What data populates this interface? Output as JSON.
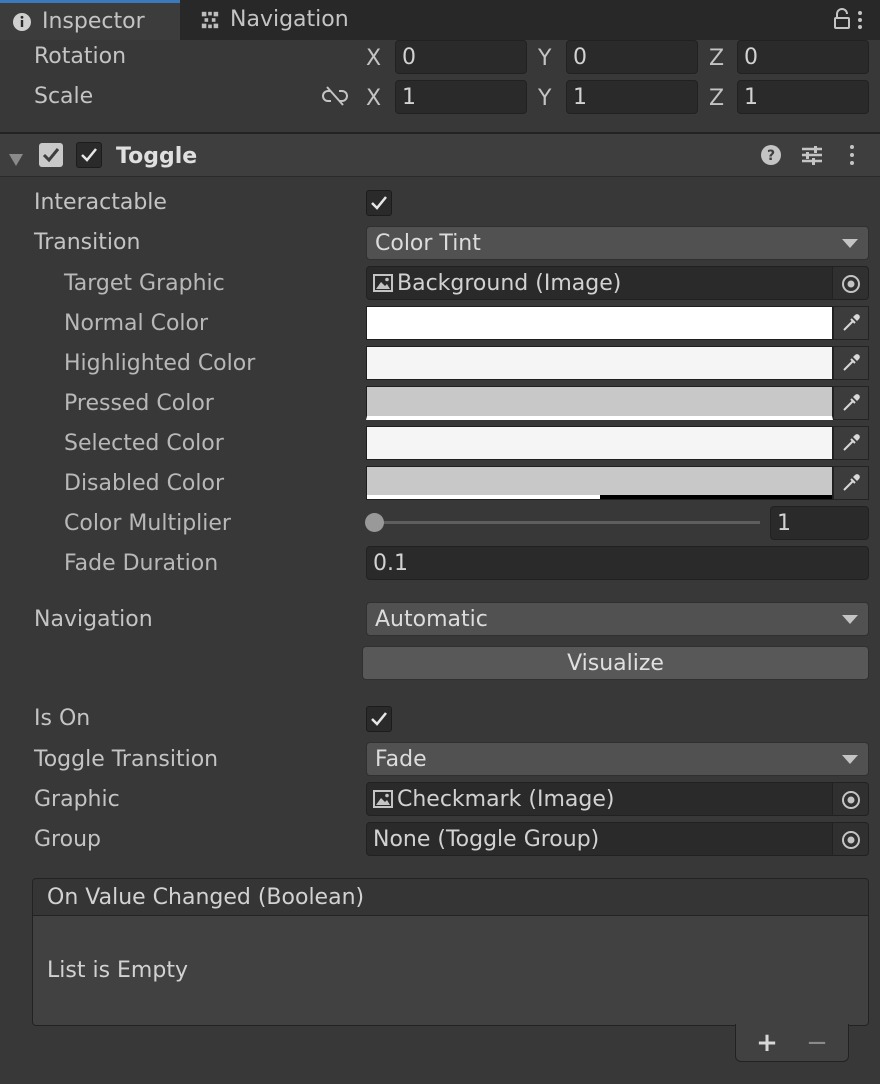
{
  "tabs": {
    "inspector": "Inspector",
    "navigation": "Navigation"
  },
  "transform": {
    "rotation": {
      "label": "Rotation",
      "x": "0",
      "y": "0",
      "z": "0"
    },
    "scale": {
      "label": "Scale",
      "x": "1",
      "y": "1",
      "z": "1"
    },
    "axis_x": "X",
    "axis_y": "Y",
    "axis_z": "Z"
  },
  "component": {
    "title": "Toggle",
    "enabled": true
  },
  "fields": {
    "interactable": {
      "label": "Interactable",
      "checked": true
    },
    "transition": {
      "label": "Transition",
      "value": "Color Tint"
    },
    "target_graphic": {
      "label": "Target Graphic",
      "value": "Background (Image)"
    },
    "normal_color": {
      "label": "Normal Color",
      "color": "#FFFFFF"
    },
    "highlighted_color": {
      "label": "Highlighted Color",
      "color": "#F5F5F5"
    },
    "pressed_color": {
      "label": "Pressed Color",
      "color": "#C8C8C8"
    },
    "selected_color": {
      "label": "Selected Color",
      "color": "#F5F5F5"
    },
    "disabled_color": {
      "label": "Disabled Color",
      "color": "#C8C8C8"
    },
    "color_multiplier": {
      "label": "Color Multiplier",
      "value": "1",
      "slider_fraction": 0
    },
    "fade_duration": {
      "label": "Fade Duration",
      "value": "0.1"
    },
    "navigation": {
      "label": "Navigation",
      "value": "Automatic"
    },
    "visualize_button": "Visualize",
    "is_on": {
      "label": "Is On",
      "checked": true
    },
    "toggle_transition": {
      "label": "Toggle Transition",
      "value": "Fade"
    },
    "graphic": {
      "label": "Graphic",
      "value": "Checkmark (Image)"
    },
    "group": {
      "label": "Group",
      "value": "None (Toggle Group)"
    }
  },
  "event": {
    "header": "On Value Changed (Boolean)",
    "empty_text": "List is Empty",
    "add": "+",
    "remove": "−"
  },
  "colors": {
    "accent": "#3a79bb",
    "panel": "#383838"
  }
}
